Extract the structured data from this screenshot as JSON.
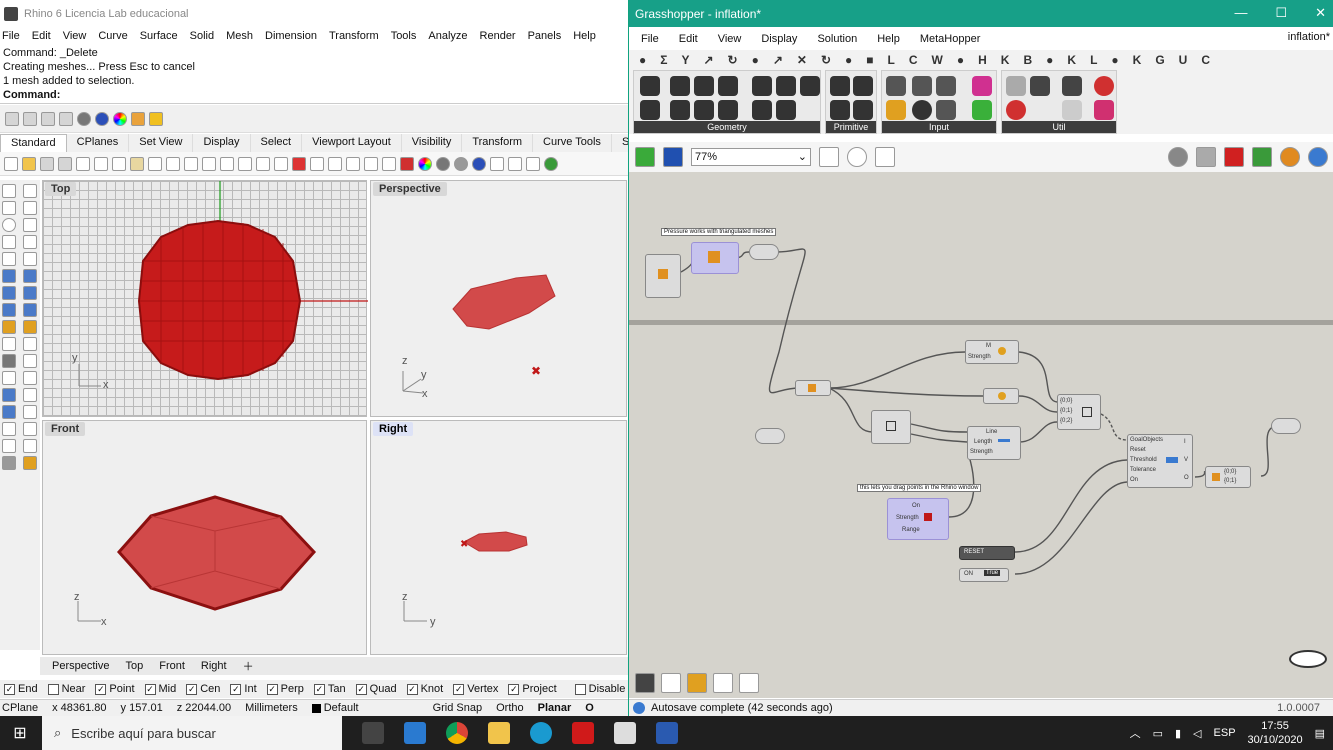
{
  "rhino": {
    "title": "Rhino 6 Licencia Lab educacional",
    "menu": [
      "File",
      "Edit",
      "View",
      "Curve",
      "Surface",
      "Solid",
      "Mesh",
      "Dimension",
      "Transform",
      "Tools",
      "Analyze",
      "Render",
      "Panels",
      "Help"
    ],
    "command_history": [
      "Command: _Delete",
      "Creating meshes... Press Esc to cancel",
      "1 mesh added to selection."
    ],
    "command_prompt": "Command:",
    "tabs": [
      "Standard",
      "CPlanes",
      "Set View",
      "Display",
      "Select",
      "Viewport Layout",
      "Visibility",
      "Transform",
      "Curve Tools",
      "Surface"
    ],
    "viewports": {
      "top": "Top",
      "perspective": "Perspective",
      "front": "Front",
      "right": "Right"
    },
    "viewport_tabs": [
      "Perspective",
      "Top",
      "Front",
      "Right"
    ],
    "axes": {
      "top": [
        "y",
        "x"
      ],
      "perspective": [
        "z",
        "y",
        "x"
      ],
      "front": [
        "z",
        "x"
      ],
      "right": [
        "z",
        "y"
      ]
    },
    "osnaps": [
      {
        "label": "End",
        "checked": true
      },
      {
        "label": "Near",
        "checked": false
      },
      {
        "label": "Point",
        "checked": true
      },
      {
        "label": "Mid",
        "checked": true
      },
      {
        "label": "Cen",
        "checked": true
      },
      {
        "label": "Int",
        "checked": true
      },
      {
        "label": "Perp",
        "checked": true
      },
      {
        "label": "Tan",
        "checked": true
      },
      {
        "label": "Quad",
        "checked": true
      },
      {
        "label": "Knot",
        "checked": true
      },
      {
        "label": "Vertex",
        "checked": true
      },
      {
        "label": "Project",
        "checked": true
      },
      {
        "label": "Disable",
        "checked": false
      }
    ],
    "status": {
      "cplane": "CPlane",
      "x": "x 48361.80",
      "y": "y 157.01",
      "z": "z 22044.00",
      "units": "Millimeters",
      "layer": "Default",
      "grid_snap": "Grid Snap",
      "ortho": "Ortho",
      "planar": "Planar",
      "osnap": "O"
    }
  },
  "grasshopper": {
    "title": "Grasshopper - inflation*",
    "window_buttons": [
      "—",
      "☐",
      "✕"
    ],
    "menu": [
      "File",
      "Edit",
      "View",
      "Display",
      "Solution",
      "Help",
      "MetaHopper"
    ],
    "document": "inflation*",
    "category_tabs": [
      "●",
      "Σ",
      "Y",
      "↗",
      "↻",
      "●",
      "↗",
      "✕",
      "↻",
      "●",
      "■",
      "L",
      "C",
      "W",
      "●",
      "H",
      "K",
      "B",
      "●",
      "K",
      "L",
      "●",
      "K",
      "G",
      "U",
      "C"
    ],
    "panels": [
      "Geometry",
      "Primitive",
      "Input",
      "Util"
    ],
    "zoom": "77%",
    "canvas": {
      "tag_pressure": "Pressure works with triangulated meshes",
      "tag_drag": "this lets you drag points in the Rhino window",
      "goal_inputs": [
        "GoalObjects",
        "Reset",
        "Threshold",
        "Tolerance",
        "On"
      ],
      "goal_outputs": [
        "I",
        "V",
        "O"
      ],
      "reset_label": "RESET",
      "toggle_label": "ON",
      "toggle_value": "True",
      "pressure_inputs": [
        "M",
        "Strength"
      ],
      "line_inputs": [
        "Line",
        "Length",
        "Strength"
      ],
      "grab_inputs": [
        "On",
        "Strength",
        "Range"
      ],
      "merge_inputs": [
        "{0;0}",
        "{0;1}",
        "{0;2}"
      ],
      "output_labels": [
        "{0;0}",
        "{0;1}"
      ]
    },
    "status": "Autosave complete (42 seconds ago)",
    "version": "1.0.0007"
  },
  "taskbar": {
    "search_placeholder": "Escribe aquí para buscar",
    "language": "ESP",
    "time": "17:55",
    "date": "30/10/2020"
  },
  "colors": {
    "gh_title": "#17a088",
    "mesh": "#c21a1a",
    "mesh_light": "#d24a4a"
  }
}
